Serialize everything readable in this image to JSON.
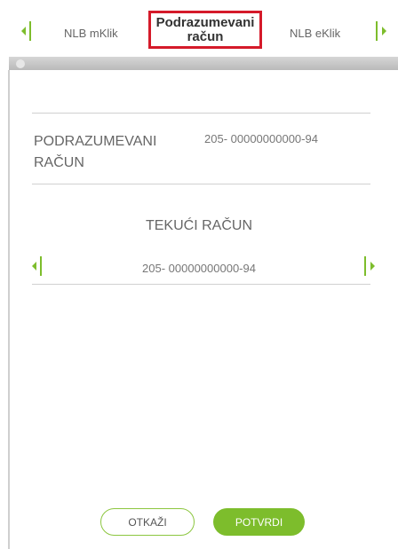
{
  "tabs": {
    "left": "NLB mKlik",
    "active": "Podrazumevani račun",
    "right": "NLB eKlik"
  },
  "icons": {
    "tab_prev": "chevron-left-icon",
    "tab_next": "chevron-right-icon",
    "account_prev": "chevron-left-icon",
    "account_next": "chevron-right-icon"
  },
  "colors": {
    "accent": "#7dbd2c",
    "highlight": "#d51a2a"
  },
  "default_account": {
    "label": "PODRAZUMEVANI RAČUN",
    "value": "205- 00000000000-94"
  },
  "account_selector": {
    "title": "TEKUĆI RAČUN",
    "value": "205- 00000000000-94"
  },
  "buttons": {
    "cancel": "OTKAŽI",
    "confirm": "POTVRDI"
  }
}
